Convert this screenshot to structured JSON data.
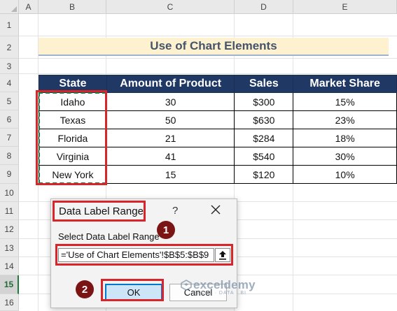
{
  "columns": [
    "A",
    "B",
    "C",
    "D",
    "E"
  ],
  "rows": [
    "1",
    "2",
    "3",
    "4",
    "5",
    "6",
    "7",
    "8",
    "9",
    "10",
    "11",
    "12",
    "13",
    "14",
    "15",
    "16"
  ],
  "title": "Use of Chart Elements",
  "table": {
    "headers": [
      "State",
      "Amount of Product",
      "Sales",
      "Market Share"
    ],
    "rows": [
      [
        "Idaho",
        "30",
        "$300",
        "15%"
      ],
      [
        "Texas",
        "50",
        "$630",
        "23%"
      ],
      [
        "Florida",
        "21",
        "$284",
        "18%"
      ],
      [
        "Virginia",
        "41",
        "$540",
        "30%"
      ],
      [
        "New York",
        "15",
        "$120",
        "10%"
      ]
    ]
  },
  "dialog": {
    "title": "Data Label Range",
    "help": "?",
    "label": "Select Data Label Range",
    "input_value": "='Use of Chart Elements'!$B$5:$B$9",
    "ok": "OK",
    "cancel": "Cancel"
  },
  "badges": [
    "1",
    "2"
  ],
  "watermark": {
    "name": "exceldemy",
    "sub": "EXCEL · DATA · BI"
  },
  "colors": {
    "header_bg": "#203864",
    "title_bg": "#fdf1d0",
    "highlight": "#d9252a",
    "badge": "#7b1414",
    "selection": "#1f7a3d"
  }
}
